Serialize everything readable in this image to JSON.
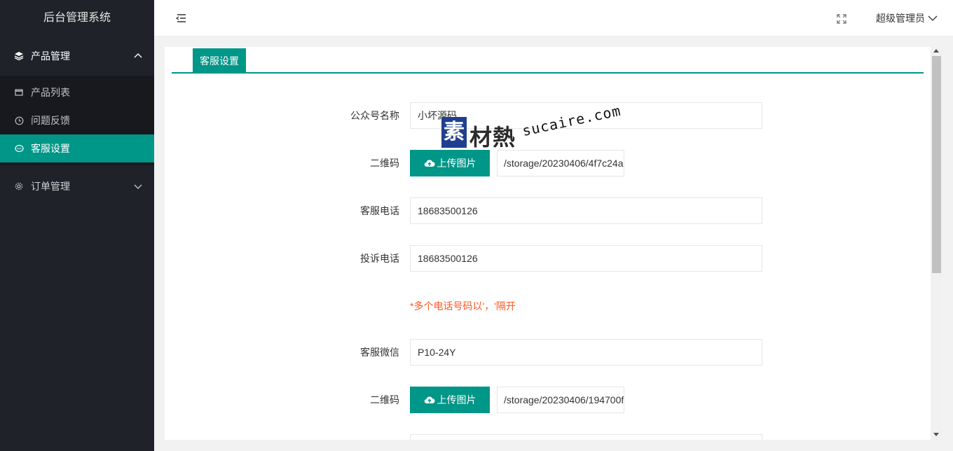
{
  "app": {
    "title": "后台管理系统"
  },
  "sidebar": {
    "groups": [
      {
        "label": "产品管理",
        "items": [
          {
            "label": "产品列表"
          },
          {
            "label": "问题反馈"
          },
          {
            "label": "客服设置"
          }
        ]
      },
      {
        "label": "订单管理"
      }
    ]
  },
  "header": {
    "user": "超级管理员"
  },
  "tabs": [
    {
      "label": "客服设置"
    }
  ],
  "form": {
    "account_name": {
      "label": "公众号名称",
      "value": "小坏源码"
    },
    "qrcode1": {
      "label": "二维码",
      "button": "上传图片",
      "path": "/storage/20230406/4f7c24a"
    },
    "service_phone": {
      "label": "客服电话",
      "value": "18683500126"
    },
    "complaint_phone": {
      "label": "投诉电话",
      "value": "18683500126"
    },
    "hint": "*多个电话号码以'，'隔开",
    "wechat": {
      "label": "客服微信",
      "value": "P10-24Y"
    },
    "qrcode2": {
      "label": "二维码",
      "button": "上传图片",
      "path": "/storage/20230406/194700f"
    }
  },
  "watermark": {
    "mark": "素",
    "cn": "材熱",
    "en": "sucaire.com"
  },
  "colors": {
    "primary": "#009688",
    "sidebar": "#20222a",
    "hint": "#ff5722"
  }
}
